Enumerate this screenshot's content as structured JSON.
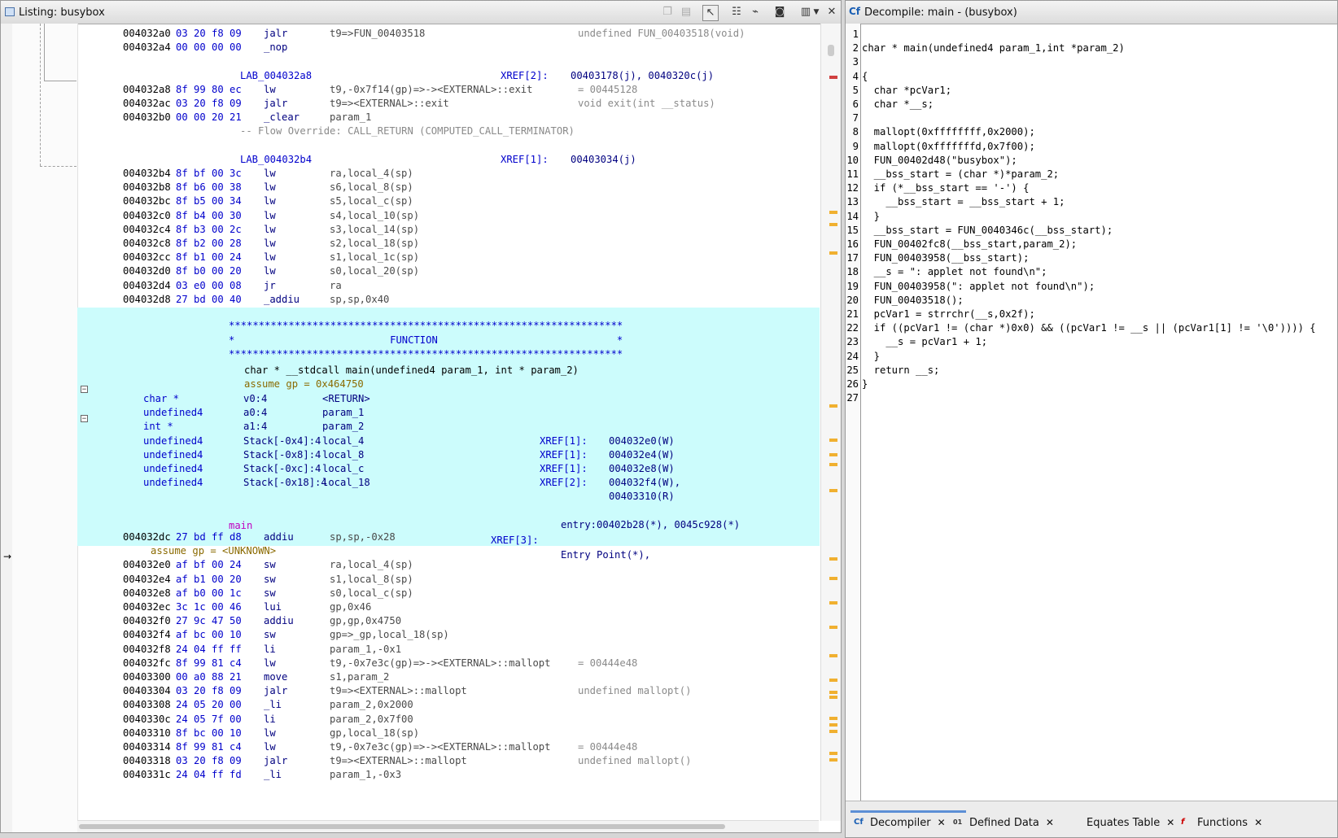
{
  "listing": {
    "title": "Listing:  busybox",
    "toolbar_icons": [
      "copy-icon",
      "paste-icon",
      "cursor-select-icon",
      "field-list-icon",
      "graph-icon",
      "snapshot-icon",
      "options-icon",
      "dropdown-icon",
      "close-icon"
    ],
    "rows": [
      {
        "type": "instr",
        "addr": "004032a0",
        "bytes": "03 20 f8 09",
        "mn": "jalr",
        "op": "t9=>FUN_00403518",
        "cm": "undefined FUN_00403518(void)"
      },
      {
        "type": "instr",
        "addr": "004032a4",
        "bytes": "00 00 00 00",
        "mn": "_nop",
        "op": "",
        "cm": ""
      },
      {
        "type": "blank"
      },
      {
        "type": "label",
        "label": "LAB_004032a8",
        "xlabel": "XREF[2]:",
        "xval": "00403178(j), 0040320c(j)"
      },
      {
        "type": "instr",
        "addr": "004032a8",
        "bytes": "8f 99 80 ec",
        "mn": "lw",
        "op": "t9,-0x7f14(gp)=>-><EXTERNAL>::exit",
        "cm": "= 00445128"
      },
      {
        "type": "instr",
        "addr": "004032ac",
        "bytes": "03 20 f8 09",
        "mn": "jalr",
        "op": "t9=><EXTERNAL>::exit",
        "cm": "void exit(int __status)"
      },
      {
        "type": "instr",
        "addr": "004032b0",
        "bytes": "00 00 20 21",
        "mn": "_clear",
        "op": "param_1",
        "cm": ""
      },
      {
        "type": "note",
        "text": "-- Flow Override: CALL_RETURN (COMPUTED_CALL_TERMINATOR)"
      },
      {
        "type": "blank"
      },
      {
        "type": "label",
        "label": "LAB_004032b4",
        "xlabel": "XREF[1]:",
        "xval": "00403034(j)"
      },
      {
        "type": "instr",
        "addr": "004032b4",
        "bytes": "8f bf 00 3c",
        "mn": "lw",
        "op": "ra,local_4(sp)",
        "cm": ""
      },
      {
        "type": "instr",
        "addr": "004032b8",
        "bytes": "8f b6 00 38",
        "mn": "lw",
        "op": "s6,local_8(sp)",
        "cm": ""
      },
      {
        "type": "instr",
        "addr": "004032bc",
        "bytes": "8f b5 00 34",
        "mn": "lw",
        "op": "s5,local_c(sp)",
        "cm": ""
      },
      {
        "type": "instr",
        "addr": "004032c0",
        "bytes": "8f b4 00 30",
        "mn": "lw",
        "op": "s4,local_10(sp)",
        "cm": ""
      },
      {
        "type": "instr",
        "addr": "004032c4",
        "bytes": "8f b3 00 2c",
        "mn": "lw",
        "op": "s3,local_14(sp)",
        "cm": ""
      },
      {
        "type": "instr",
        "addr": "004032c8",
        "bytes": "8f b2 00 28",
        "mn": "lw",
        "op": "s2,local_18(sp)",
        "cm": ""
      },
      {
        "type": "instr",
        "addr": "004032cc",
        "bytes": "8f b1 00 24",
        "mn": "lw",
        "op": "s1,local_1c(sp)",
        "cm": ""
      },
      {
        "type": "instr",
        "addr": "004032d0",
        "bytes": "8f b0 00 20",
        "mn": "lw",
        "op": "s0,local_20(sp)",
        "cm": ""
      },
      {
        "type": "instr",
        "addr": "004032d4",
        "bytes": "03 e0 00 08",
        "mn": "jr",
        "op": "ra",
        "cm": ""
      },
      {
        "type": "instr",
        "addr": "004032d8",
        "bytes": "27 bd 00 40",
        "mn": "_addiu",
        "op": "sp,sp,0x40",
        "cm": ""
      }
    ],
    "function_header": {
      "stars": "******************************************************************",
      "banner": "*                          FUNCTION                              *",
      "signature": "char * __stdcall main(undefined4 param_1, int * param_2)",
      "assume": "assume gp = 0x464750",
      "vars": [
        {
          "type": "char *",
          "storage": "v0:4",
          "name": "<RETURN>",
          "xlabel": "",
          "xval": ""
        },
        {
          "type": "undefined4",
          "storage": "a0:4",
          "name": "param_1",
          "xlabel": "",
          "xval": ""
        },
        {
          "type": "int *",
          "storage": "a1:4",
          "name": "param_2",
          "xlabel": "",
          "xval": ""
        },
        {
          "type": "undefined4",
          "storage": "Stack[-0x4]:4",
          "name": "local_4",
          "xlabel": "XREF[1]:",
          "xval": "004032e0(W)"
        },
        {
          "type": "undefined4",
          "storage": "Stack[-0x8]:4",
          "name": "local_8",
          "xlabel": "XREF[1]:",
          "xval": "004032e4(W)"
        },
        {
          "type": "undefined4",
          "storage": "Stack[-0xc]:4",
          "name": "local_c",
          "xlabel": "XREF[1]:",
          "xval": "004032e8(W)"
        },
        {
          "type": "undefined4",
          "storage": "Stack[-0x18]:4",
          "name": "local_18",
          "xlabel": "XREF[2]:",
          "xval": "004032f4(W),"
        }
      ],
      "extra_xref": "00403310(R)",
      "func_label": "main",
      "func_xlabel": "XREF[3]:",
      "func_xval1": "Entry Point(*),",
      "func_xval2": "entry:00402b28(*), 0045c928(*)"
    },
    "rows2": [
      {
        "type": "instr",
        "addr": "004032dc",
        "bytes": "27 bd ff d8",
        "mn": "addiu",
        "op": "sp,sp,-0x28",
        "cm": ""
      },
      {
        "type": "assume",
        "text": "assume gp = <UNKNOWN>"
      },
      {
        "type": "instr",
        "addr": "004032e0",
        "bytes": "af bf 00 24",
        "mn": "sw",
        "op": "ra,local_4(sp)",
        "cm": ""
      },
      {
        "type": "instr",
        "addr": "004032e4",
        "bytes": "af b1 00 20",
        "mn": "sw",
        "op": "s1,local_8(sp)",
        "cm": ""
      },
      {
        "type": "instr",
        "addr": "004032e8",
        "bytes": "af b0 00 1c",
        "mn": "sw",
        "op": "s0,local_c(sp)",
        "cm": ""
      },
      {
        "type": "instr",
        "addr": "004032ec",
        "bytes": "3c 1c 00 46",
        "mn": "lui",
        "op": "gp,0x46",
        "cm": ""
      },
      {
        "type": "instr",
        "addr": "004032f0",
        "bytes": "27 9c 47 50",
        "mn": "addiu",
        "op": "gp,gp,0x4750",
        "cm": ""
      },
      {
        "type": "instr",
        "addr": "004032f4",
        "bytes": "af bc 00 10",
        "mn": "sw",
        "op": "gp=>_gp,local_18(sp)",
        "cm": ""
      },
      {
        "type": "instr",
        "addr": "004032f8",
        "bytes": "24 04 ff ff",
        "mn": "li",
        "op": "param_1,-0x1",
        "cm": ""
      },
      {
        "type": "instr",
        "addr": "004032fc",
        "bytes": "8f 99 81 c4",
        "mn": "lw",
        "op": "t9,-0x7e3c(gp)=>-><EXTERNAL>::mallopt",
        "cm": "= 00444e48"
      },
      {
        "type": "instr",
        "addr": "00403300",
        "bytes": "00 a0 88 21",
        "mn": "move",
        "op": "s1,param_2",
        "cm": ""
      },
      {
        "type": "instr",
        "addr": "00403304",
        "bytes": "03 20 f8 09",
        "mn": "jalr",
        "op": "t9=><EXTERNAL>::mallopt",
        "cm": "undefined mallopt()"
      },
      {
        "type": "instr",
        "addr": "00403308",
        "bytes": "24 05 20 00",
        "mn": "_li",
        "op": "param_2,0x2000",
        "cm": ""
      },
      {
        "type": "instr",
        "addr": "0040330c",
        "bytes": "24 05 7f 00",
        "mn": "li",
        "op": "param_2,0x7f00",
        "cm": ""
      },
      {
        "type": "instr",
        "addr": "00403310",
        "bytes": "8f bc 00 10",
        "mn": "lw",
        "op": "gp,local_18(sp)",
        "cm": ""
      },
      {
        "type": "instr",
        "addr": "00403314",
        "bytes": "8f 99 81 c4",
        "mn": "lw",
        "op": "t9,-0x7e3c(gp)=>-><EXTERNAL>::mallopt",
        "cm": "= 00444e48"
      },
      {
        "type": "instr",
        "addr": "00403318",
        "bytes": "03 20 f8 09",
        "mn": "jalr",
        "op": "t9=><EXTERNAL>::mallopt",
        "cm": "undefined mallopt()"
      },
      {
        "type": "instr",
        "addr": "0040331c",
        "bytes": "24 04 ff fd",
        "mn": "_li",
        "op": "param_1,-0x3",
        "cm": ""
      }
    ]
  },
  "decompile": {
    "title": "Decompile: main -  (busybox)",
    "lines": [
      "",
      "char * main(undefined4 param_1,int *param_2)",
      "",
      "{",
      "  char *pcVar1;",
      "  char *__s;",
      "",
      "  mallopt(0xffffffff,0x2000);",
      "  mallopt(0xfffffffd,0x7f00);",
      "  FUN_00402d48(\"busybox\");",
      "  __bss_start = (char *)*param_2;",
      "  if (*__bss_start == '-') {",
      "    __bss_start = __bss_start + 1;",
      "  }",
      "  __bss_start = FUN_0040346c(__bss_start);",
      "  FUN_00402fc8(__bss_start,param_2);",
      "  FUN_00403958(__bss_start);",
      "  __s = \": applet not found\\n\";",
      "  FUN_00403958(\": applet not found\\n\");",
      "  FUN_00403518();",
      "  pcVar1 = strrchr(__s,0x2f);",
      "  if ((pcVar1 != (char *)0x0) && ((pcVar1 != __s || (pcVar1[1] != '\\0')))) {",
      "    __s = pcVar1 + 1;",
      "  }",
      "  return __s;",
      "}",
      ""
    ],
    "tabs": [
      {
        "label": "Decompiler",
        "icon": "Cf"
      },
      {
        "label": "Defined Data",
        "icon": "01"
      },
      {
        "label": "Equates Table",
        "icon": ""
      },
      {
        "label": "Functions",
        "icon": "f"
      }
    ]
  }
}
